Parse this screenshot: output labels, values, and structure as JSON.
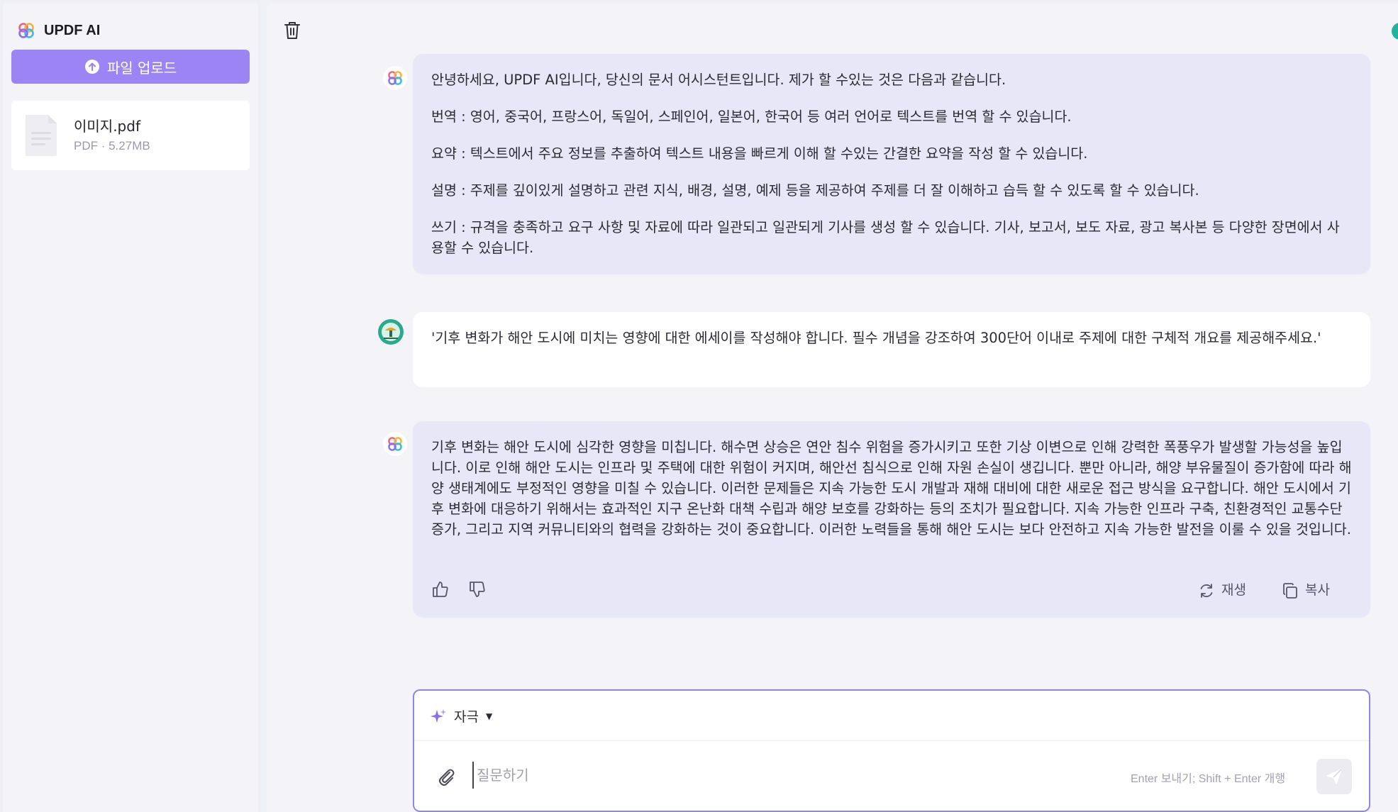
{
  "app": {
    "title": "UPDF AI"
  },
  "sidebar": {
    "upload_label": "파일 업로드",
    "file": {
      "name": "이미지.pdf",
      "meta": "PDF · 5.27MB"
    }
  },
  "messages": {
    "intro": {
      "lines": [
        "안녕하세요, UPDF AI입니다, 당신의 문서 어시스턴트입니다. 제가 할 수있는 것은 다음과 같습니다.",
        "번역 : 영어, 중국어, 프랑스어, 독일어, 스페인어, 일본어, 한국어 등 여러 언어로 텍스트를 번역 할 수 있습니다.",
        "요약 : 텍스트에서 주요 정보를 추출하여 텍스트 내용을 빠르게 이해 할 수있는 간결한 요약을 작성 할 수 있습니다.",
        "설명 : 주제를 깊이있게 설명하고 관련 지식, 배경, 설명, 예제 등을 제공하여 주제를 더 잘 이해하고 습득 할 수 있도록 할 수 있습니다.",
        "쓰기 : 규격을 충족하고 요구 사항 및 자료에 따라 일관되고 일관되게 기사를 생성 할 수 있습니다. 기사, 보고서, 보도 자료, 광고 복사본 등 다양한 장면에서 사용할 수 있습니다."
      ]
    },
    "user": {
      "text": "'기후 변화가 해안 도시에 미치는 영향에 대한 에세이를 작성해야 합니다. 필수 개념을 강조하여 300단어 이내로 주제에 대한 구체적 개요를 제공해주세요.'"
    },
    "answer": {
      "text": "기후 변화는 해안 도시에 심각한 영향을 미칩니다. 해수면 상승은 연안 침수 위험을 증가시키고 또한 기상 이변으로 인해 강력한 폭풍우가 발생할 가능성을 높입니다. 이로 인해 해안 도시는 인프라 및 주택에 대한 위험이 커지며, 해안선 침식으로 인해 자원 손실이 생깁니다. 뿐만 아니라, 해양 부유물질이 증가함에 따라 해양 생태계에도 부정적인 영향을 미칠 수 있습니다. 이러한 문제들은 지속 가능한 도시 개발과 재해 대비에 대한 새로운 접근 방식을 요구합니다. 해안 도시에서 기후 변화에 대응하기 위해서는 효과적인 지구 온난화 대책 수립과 해양 보호를 강화하는 등의 조치가 필요합니다. 지속 가능한 인프라 구축, 친환경적인 교통수단 증가, 그리고 지역 커뮤니티와의 협력을 강화하는 것이 중요합니다. 이러한 노력들을 통해 해안 도시는 보다 안전하고 지속 가능한 발전을 이룰 수 있을 것입니다.",
      "regenerate_label": "재생",
      "copy_label": "복사"
    }
  },
  "composer": {
    "mode_label": "자극",
    "placeholder": "질문하기",
    "hint": "Enter 보내기; Shift + Enter 개행"
  },
  "icons": {
    "logo": "updf-flower-logo-icon",
    "upload": "arrow-up-circle-icon",
    "file": "document-icon",
    "trash": "trash-icon",
    "avatar_user": "user-avatar-icon",
    "thumbs_up": "thumbs-up-icon",
    "thumbs_down": "thumbs-down-icon",
    "regenerate": "refresh-icon",
    "copy": "copy-icon",
    "sparkle": "sparkle-icon",
    "attach": "paperclip-icon",
    "send": "send-icon"
  },
  "colors": {
    "accent": "#9b84f4",
    "ai_bubble": "#e8e7f7",
    "input_border": "#8d86ee"
  }
}
